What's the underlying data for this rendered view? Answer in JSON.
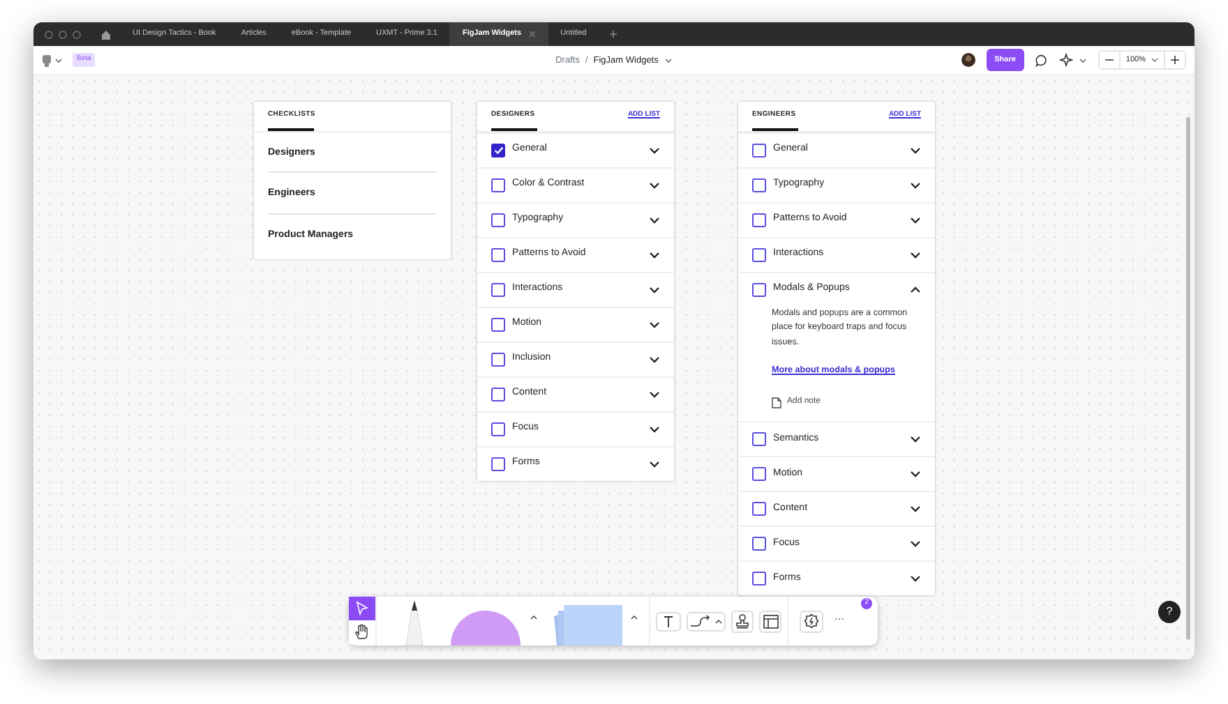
{
  "window": {
    "tabs": [
      {
        "label": "UI Design Tactics - Book",
        "selected": false
      },
      {
        "label": "Articles",
        "selected": false
      },
      {
        "label": "eBook - Template",
        "selected": false
      },
      {
        "label": "UXMT - Prime 3.1",
        "selected": false
      },
      {
        "label": "FigJam Widgets",
        "selected": true
      },
      {
        "label": "Untitled",
        "selected": false
      }
    ]
  },
  "toolbar": {
    "badge": "Beta",
    "breadcrumb": "Drafts",
    "separator": "/",
    "file_name": "FigJam Widgets",
    "share": "Share",
    "zoom": "100%"
  },
  "checklists_card": {
    "title": "CHECKLISTS",
    "items": [
      "Designers",
      "Engineers",
      "Product Managers"
    ]
  },
  "lists": [
    {
      "title": "DESIGNERS",
      "add_link": "ADD LIST",
      "items": [
        {
          "label": "General",
          "checked": true,
          "expanded": false
        },
        {
          "label": "Color & Contrast",
          "checked": false,
          "expanded": false
        },
        {
          "label": "Typography",
          "checked": false,
          "expanded": false
        },
        {
          "label": "Patterns to Avoid",
          "checked": false,
          "expanded": false
        },
        {
          "label": "Interactions",
          "checked": false,
          "expanded": false
        },
        {
          "label": "Motion",
          "checked": false,
          "expanded": false
        },
        {
          "label": "Inclusion",
          "checked": false,
          "expanded": false
        },
        {
          "label": "Content",
          "checked": false,
          "expanded": false
        },
        {
          "label": "Focus",
          "checked": false,
          "expanded": false
        },
        {
          "label": "Forms",
          "checked": false,
          "expanded": false
        }
      ]
    },
    {
      "title": "ENGINEERS",
      "add_link": "ADD LIST",
      "items": [
        {
          "label": "General",
          "checked": false,
          "expanded": false
        },
        {
          "label": "Typography",
          "checked": false,
          "expanded": false
        },
        {
          "label": "Patterns to Avoid",
          "checked": false,
          "expanded": false
        },
        {
          "label": "Interactions",
          "checked": false,
          "expanded": false
        },
        {
          "label": "Modals & Popups",
          "checked": false,
          "expanded": true,
          "description": "Modals and popups are a common place for keyboard traps and focus issues.",
          "link": "More about modals & popups",
          "note": "Add note"
        },
        {
          "label": "Semantics",
          "checked": false,
          "expanded": false
        },
        {
          "label": "Motion",
          "checked": false,
          "expanded": false
        },
        {
          "label": "Content",
          "checked": false,
          "expanded": false
        },
        {
          "label": "Focus",
          "checked": false,
          "expanded": false
        },
        {
          "label": "Forms",
          "checked": false,
          "expanded": false
        }
      ]
    }
  ],
  "bottom_toolbar": {
    "tools": [
      {
        "kind": "select",
        "selected": true
      },
      {
        "kind": "hand",
        "selected": false
      }
    ],
    "more": "···",
    "notification_count": "2"
  },
  "help": "?"
}
